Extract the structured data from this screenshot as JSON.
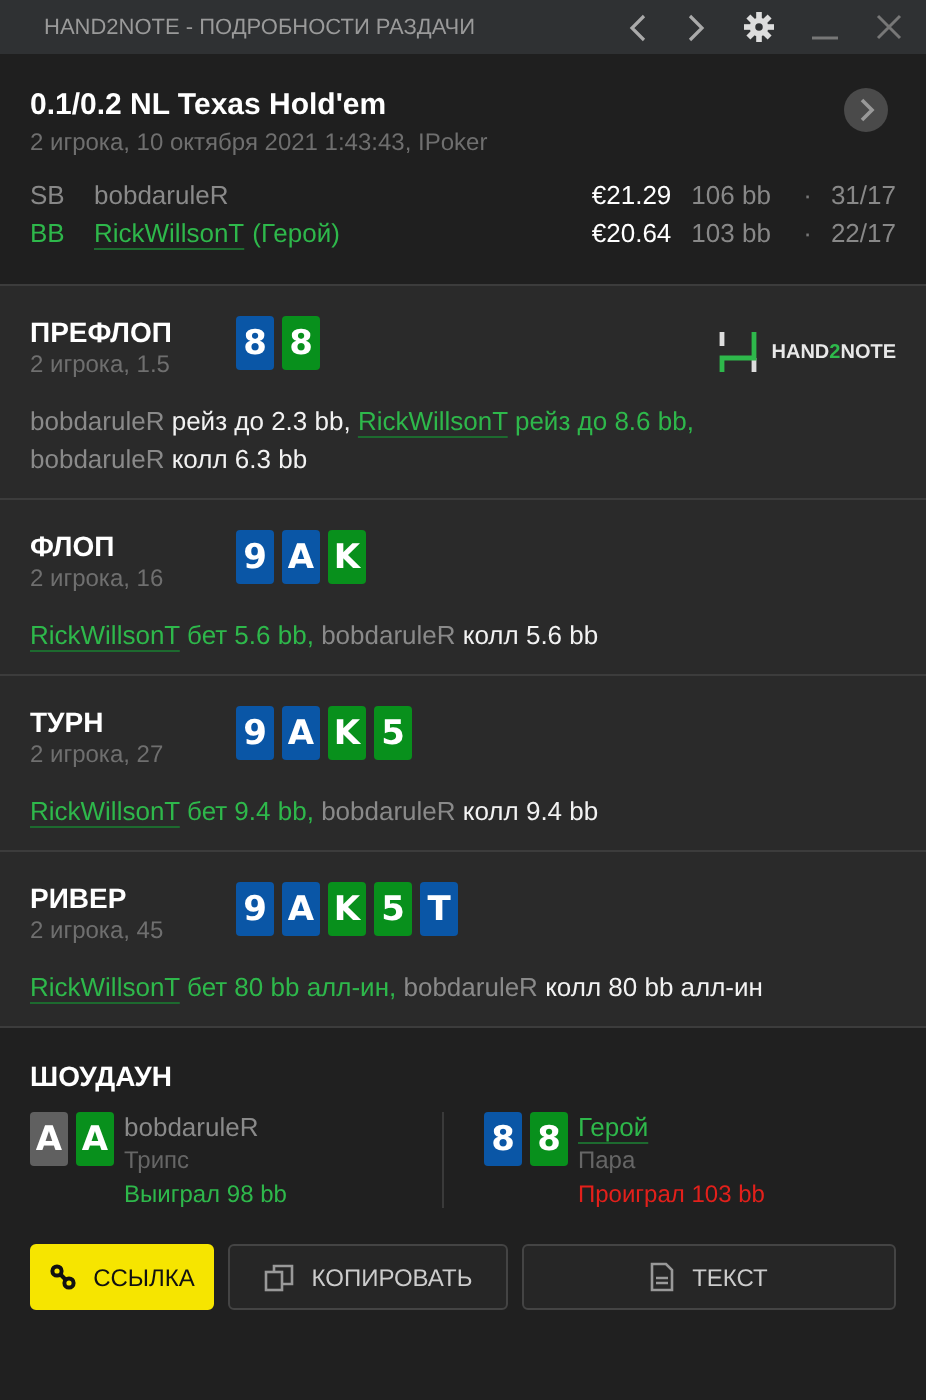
{
  "window": {
    "title": "HAND2NOTE - ПОДРОБНОСТИ РАЗДАЧИ"
  },
  "hand": {
    "game": "0.1/0.2 NL Texas Hold'em",
    "info": "2 игрока, 10 октября 2021 1:43:43, IPoker",
    "players": [
      {
        "position": "SB",
        "name": "bobdaruleR",
        "hero": false,
        "stack": "€21.29",
        "bb": "106 bb",
        "separator": "·",
        "stat": "31/17"
      },
      {
        "position": "BB",
        "name": "RickWillsonT",
        "hero": true,
        "hero_tag": "(Герой)",
        "stack": "€20.64",
        "bb": "103 bb",
        "separator": "·",
        "stat": "22/17"
      }
    ]
  },
  "logo": "HAND**2**NOTE",
  "streets": [
    {
      "title": "ПРЕФЛОП",
      "info": "2 игрока, 1.5",
      "logo": true,
      "cards": [
        {
          "rank": "8",
          "color": "#0a56a6"
        },
        {
          "rank": "8",
          "color": "#08901c"
        }
      ],
      "actions": [
        {
          "player": "bobdaruleR",
          "hero": false,
          "text": "рейз до 2.3 bb,"
        },
        {
          "player": "RickWillsonT",
          "hero": true,
          "text": "рейз до 8.6 bb,"
        },
        {
          "player": "bobdaruleR",
          "hero": false,
          "text": "колл 6.3 bb"
        }
      ]
    },
    {
      "title": "ФЛОП",
      "info": "2 игрока, 16",
      "logo": false,
      "cards": [
        {
          "rank": "9",
          "color": "#0a56a6"
        },
        {
          "rank": "A",
          "color": "#0a56a6"
        },
        {
          "rank": "K",
          "color": "#08901c"
        }
      ],
      "actions": [
        {
          "player": "RickWillsonT",
          "hero": true,
          "text": "бет 5.6 bb,"
        },
        {
          "player": "bobdaruleR",
          "hero": false,
          "text": "колл 5.6 bb"
        }
      ]
    },
    {
      "title": "ТУРН",
      "info": "2 игрока, 27",
      "logo": false,
      "cards": [
        {
          "rank": "9",
          "color": "#0a56a6"
        },
        {
          "rank": "A",
          "color": "#0a56a6"
        },
        {
          "rank": "K",
          "color": "#08901c"
        },
        {
          "rank": "5",
          "color": "#08901c"
        }
      ],
      "actions": [
        {
          "player": "RickWillsonT",
          "hero": true,
          "text": "бет 9.4 bb,"
        },
        {
          "player": "bobdaruleR",
          "hero": false,
          "text": "колл 9.4 bb"
        }
      ]
    },
    {
      "title": "РИВЕР",
      "info": "2 игрока, 45",
      "logo": false,
      "cards": [
        {
          "rank": "9",
          "color": "#0a56a6"
        },
        {
          "rank": "A",
          "color": "#0a56a6"
        },
        {
          "rank": "K",
          "color": "#08901c"
        },
        {
          "rank": "5",
          "color": "#08901c"
        },
        {
          "rank": "T",
          "color": "#0a56a6"
        }
      ],
      "actions": [
        {
          "player": "RickWillsonT",
          "hero": true,
          "text": "бет 80 bb алл-ин,"
        },
        {
          "player": "bobdaruleR",
          "hero": false,
          "text": "колл 80 bb алл-ин"
        }
      ]
    }
  ],
  "showdown": {
    "title": "ШОУДАУН",
    "players": [
      {
        "name": "bobdaruleR",
        "hero": false,
        "hand": "Трипс",
        "result": "Выиграл 98 bb",
        "won": true,
        "cards": [
          {
            "rank": "A",
            "color": "#606060"
          },
          {
            "rank": "A",
            "color": "#08901c"
          }
        ]
      },
      {
        "name": "Герой",
        "hero": true,
        "hand": "Пара",
        "result": "Проиграл 103 bb",
        "won": false,
        "cards": [
          {
            "rank": "8",
            "color": "#0a56a6"
          },
          {
            "rank": "8",
            "color": "#08901c"
          }
        ]
      }
    ]
  },
  "buttons": [
    {
      "kind": "link",
      "label": "ССЫЛКА"
    },
    {
      "kind": "copy",
      "label": "КОПИРОВАТЬ"
    },
    {
      "kind": "text",
      "label": "ТЕКСТ"
    }
  ]
}
